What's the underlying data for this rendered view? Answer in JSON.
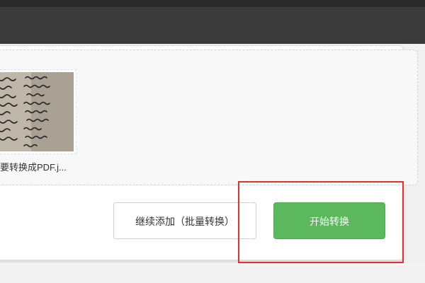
{
  "file_item": {
    "name": "要转换成PDF.j...",
    "thumbnail": "handwritten-page-image"
  },
  "buttons": {
    "add_more": "继续添加（批量转换）",
    "start": "开始转换"
  },
  "colors": {
    "top_bar": "#3b3b3b",
    "start_button": "#5cb85c",
    "highlight_box": "#e53030"
  }
}
